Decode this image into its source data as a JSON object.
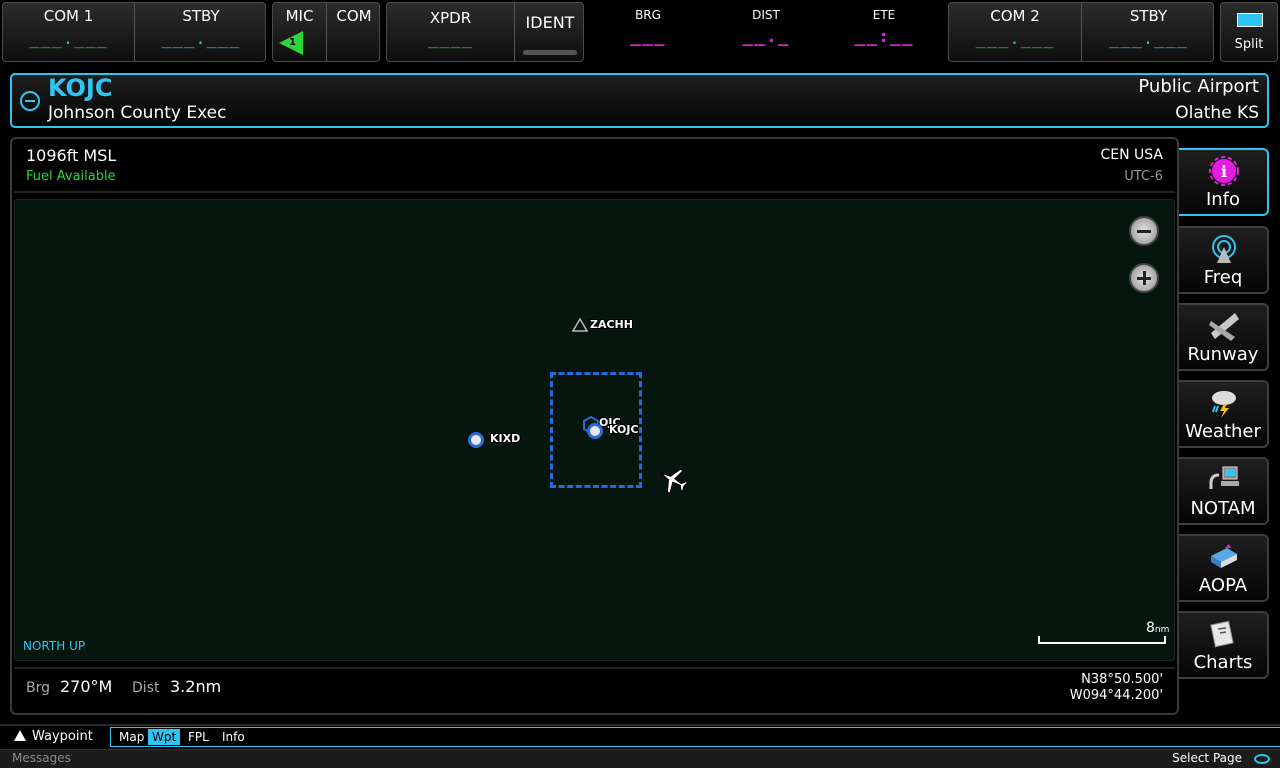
{
  "topbar": {
    "com1": {
      "label": "COM 1",
      "value": "___.___"
    },
    "stby1": {
      "label": "STBY",
      "value": "___.___"
    },
    "mic": {
      "label": "MIC",
      "indicator": "1"
    },
    "com": {
      "label": "COM"
    },
    "xpdr": {
      "label": "XPDR",
      "value": "____"
    },
    "ident": {
      "label": "IDENT"
    },
    "brg": {
      "label": "BRG",
      "value": "___"
    },
    "dist": {
      "label": "DIST",
      "value": "__._"
    },
    "ete": {
      "label": "ETE",
      "value": "__:__"
    },
    "com2": {
      "label": "COM 2",
      "value": "___.___"
    },
    "stby2": {
      "label": "STBY",
      "value": "___.___"
    },
    "split": {
      "label": "Split"
    }
  },
  "airport": {
    "id": "KOJC",
    "name": "Johnson County Exec",
    "type": "Public Airport",
    "location": "Olathe KS",
    "elevation": "1096ft MSL",
    "fuel": "Fuel Available",
    "region": "CEN USA",
    "utc": "UTC-6"
  },
  "map": {
    "waypoints": [
      {
        "id": "ZACHH"
      },
      {
        "id": "OJC"
      },
      {
        "id": "KOJC"
      },
      {
        "id": "KIXD"
      }
    ],
    "orientation": "NORTH UP",
    "scale_value": "8",
    "scale_unit": "nm"
  },
  "nav": {
    "brg_label": "Brg",
    "brg_value": "270°M",
    "dist_label": "Dist",
    "dist_value": "3.2nm",
    "lat": "N38°50.500'",
    "lon": "W094°44.200'"
  },
  "tabs": [
    {
      "label": "Info"
    },
    {
      "label": "Freq"
    },
    {
      "label": "Runway"
    },
    {
      "label": "Weather"
    },
    {
      "label": "NOTAM"
    },
    {
      "label": "AOPA"
    },
    {
      "label": "Charts"
    }
  ],
  "pagebar": {
    "current": "Waypoint",
    "tabs": [
      "Map",
      "Wpt",
      "FPL",
      "Info"
    ]
  },
  "messages": {
    "left": "Messages",
    "right": "Select Page"
  },
  "colors": {
    "accent": "#2ec5f2",
    "com_active": "#29d63a",
    "nav_data": "#e51ce0"
  }
}
